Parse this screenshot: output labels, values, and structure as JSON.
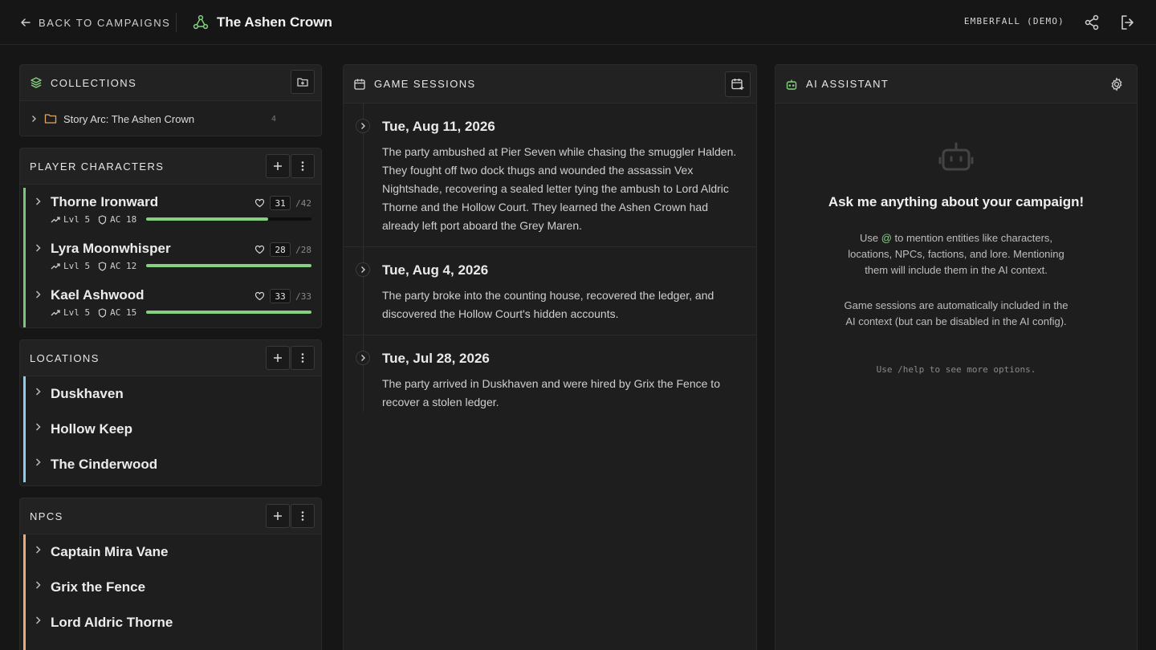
{
  "topbar": {
    "back_label": "BACK TO CAMPAIGNS",
    "campaign_name": "The Ashen Crown",
    "workspace_label": "EMBERFALL (DEMO)"
  },
  "collections": {
    "title": "COLLECTIONS",
    "items": [
      {
        "label": "Story Arc: The Ashen Crown",
        "count": "4"
      }
    ]
  },
  "players": {
    "title": "PLAYER CHARACTERS",
    "items": [
      {
        "name": "Thorne Ironward",
        "level": "Lvl 5",
        "ac": "AC 18",
        "hp": "31",
        "hp_max": "/42",
        "hp_fraction": 0.738
      },
      {
        "name": "Lyra Moonwhisper",
        "level": "Lvl 5",
        "ac": "AC 12",
        "hp": "28",
        "hp_max": "/28",
        "hp_fraction": 1.0
      },
      {
        "name": "Kael Ashwood",
        "level": "Lvl 5",
        "ac": "AC 15",
        "hp": "33",
        "hp_max": "/33",
        "hp_fraction": 1.0
      }
    ]
  },
  "locations": {
    "title": "LOCATIONS",
    "items": [
      "Duskhaven",
      "Hollow Keep",
      "The Cinderwood"
    ]
  },
  "npcs": {
    "title": "NPCS",
    "items": [
      "Captain Mira Vane",
      "Grix the Fence",
      "Lord Aldric Thorne"
    ]
  },
  "sessions": {
    "title": "GAME SESSIONS",
    "items": [
      {
        "date": "Tue, Aug 11, 2026",
        "summary": "The party ambushed at Pier Seven while chasing the smuggler Halden. They fought off two dock thugs and wounded the assassin Vex Nightshade, recovering a sealed letter tying the ambush to Lord Aldric Thorne and the Hollow Court. They learned the Ashen Crown had already left port aboard the Grey Maren."
      },
      {
        "date": "Tue, Aug 4, 2026",
        "summary": "The party broke into the counting house, recovered the ledger, and discovered the Hollow Court's hidden accounts."
      },
      {
        "date": "Tue, Jul 28, 2026",
        "summary": "The party arrived in Duskhaven and were hired by Grix the Fence to recover a stolen ledger."
      }
    ]
  },
  "assistant": {
    "title": "AI ASSISTANT",
    "heading": "Ask me anything about your campaign!",
    "mention_prefix": "Use ",
    "mention_symbol": "@",
    "mention_suffix": " to mention entities like characters, locations, NPCs, factions, and lore. Mentioning them will include them in the AI context.",
    "sessions_note": "Game sessions are automatically included in the AI context (but can be disabled in the AI config).",
    "help_hint": "Use /help to see more options."
  },
  "colors": {
    "accent_green": "#86d17f",
    "location_blue": "#8fcdf0",
    "npc_orange": "#f0a877",
    "folder_orange": "#e0a46a"
  }
}
